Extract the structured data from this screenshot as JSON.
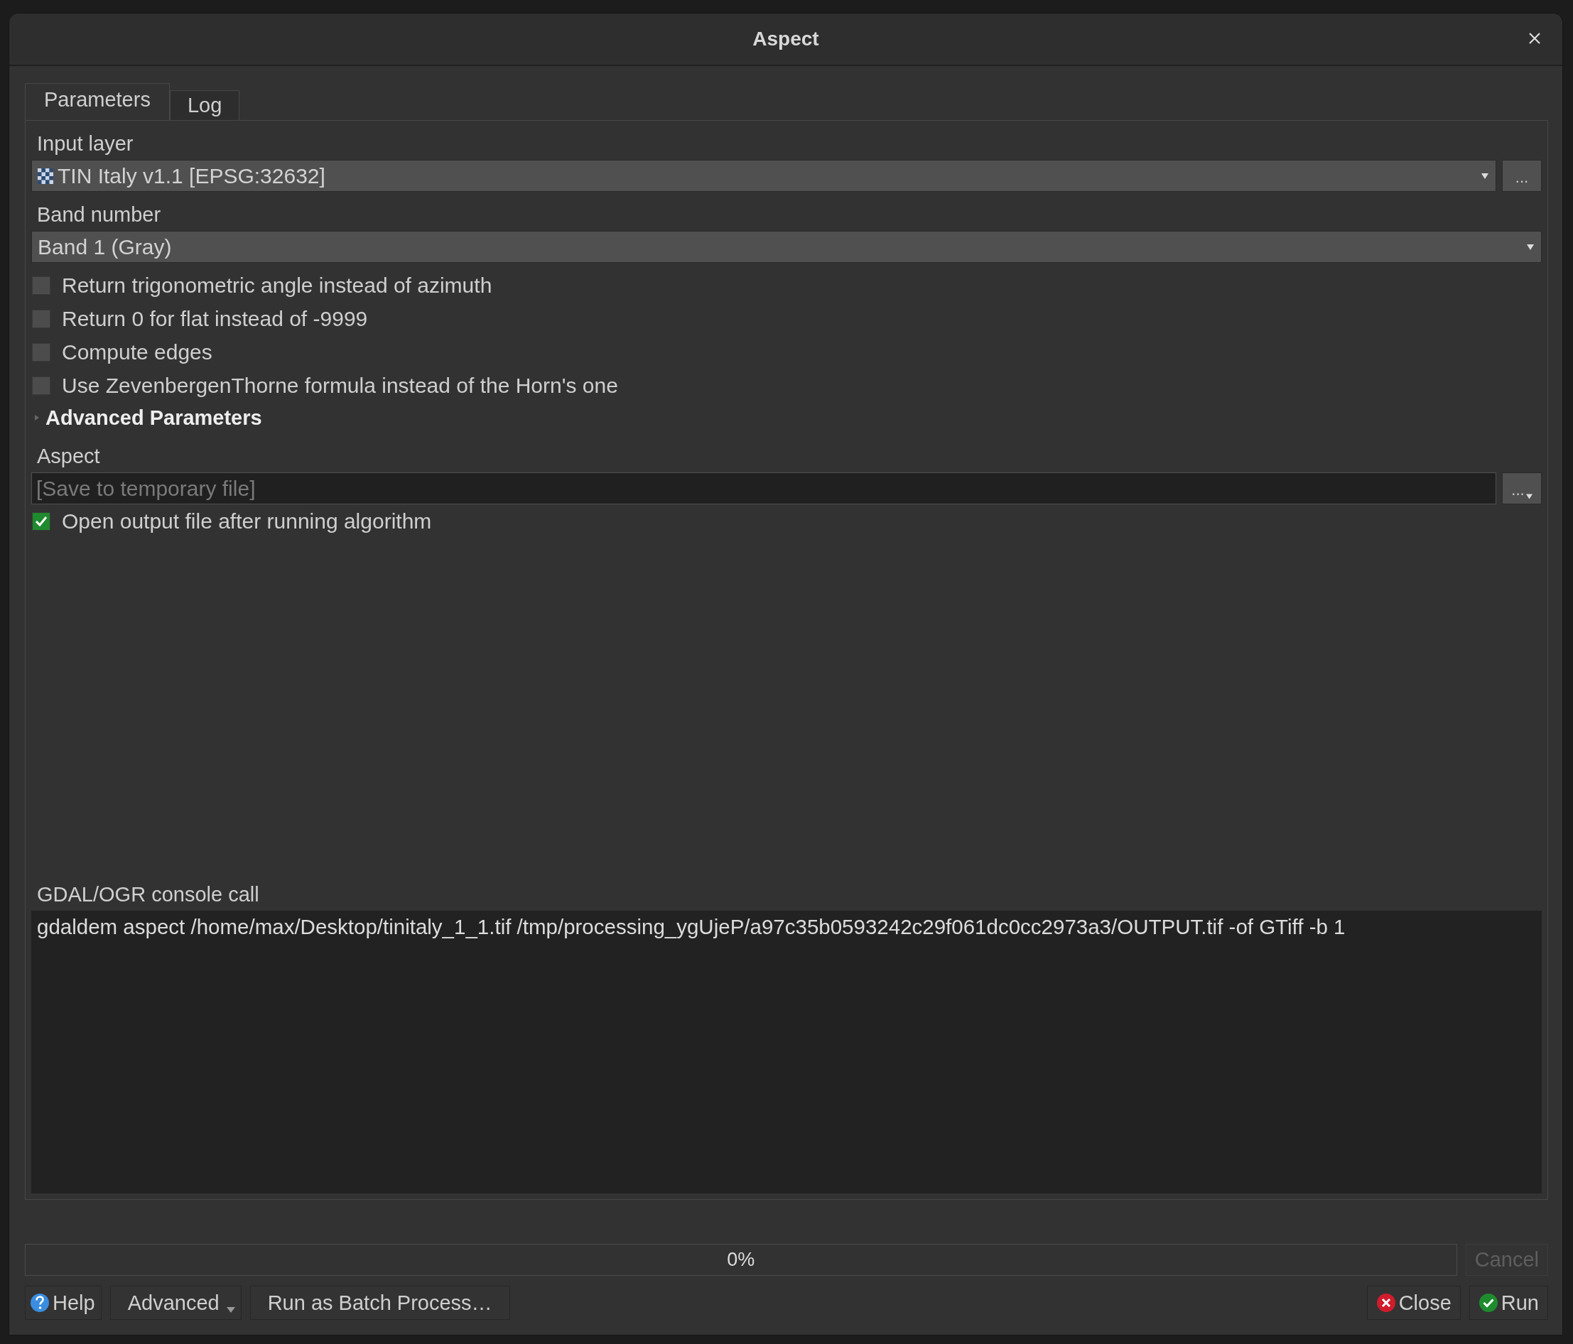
{
  "window": {
    "title": "Aspect"
  },
  "tabs": [
    {
      "label": "Parameters",
      "selected": true
    },
    {
      "label": "Log",
      "selected": false
    }
  ],
  "input_layer": {
    "label": "Input layer",
    "value": "TIN Italy v1.1 [EPSG:32632]",
    "browse": "..."
  },
  "band": {
    "label": "Band number",
    "value": "Band 1 (Gray)"
  },
  "options": [
    {
      "label": "Return trigonometric angle instead of azimuth",
      "checked": false
    },
    {
      "label": "Return 0 for flat instead of -9999",
      "checked": false
    },
    {
      "label": "Compute edges",
      "checked": false
    },
    {
      "label": "Use ZevenbergenThorne formula instead of the Horn's one",
      "checked": false
    }
  ],
  "advanced_section": {
    "label": "Advanced Parameters",
    "expanded": false
  },
  "output": {
    "label": "Aspect",
    "placeholder": "[Save to temporary file]",
    "browse": "..."
  },
  "open_output": {
    "label": "Open output file after running algorithm",
    "checked": true
  },
  "console": {
    "label": "GDAL/OGR console call",
    "command": "gdaldem aspect /home/max/Desktop/tinitaly_1_1.tif /tmp/processing_ygUjeP/a97c35b0593242c29f061dc0cc2973a3/OUTPUT.tif -of GTiff -b 1"
  },
  "progress": {
    "level": 0,
    "reading": "0%"
  },
  "cancel": {
    "label": "Cancel",
    "disabled": true
  },
  "buttons_left": [
    {
      "label": "Help",
      "kind": "help"
    },
    {
      "label": "Advanced",
      "kind": "menu"
    },
    {
      "label": "Run as Batch Process…",
      "kind": "plain"
    }
  ],
  "buttons_right": [
    {
      "label": "Close",
      "kind": "close"
    },
    {
      "label": "Run",
      "kind": "run"
    }
  ]
}
